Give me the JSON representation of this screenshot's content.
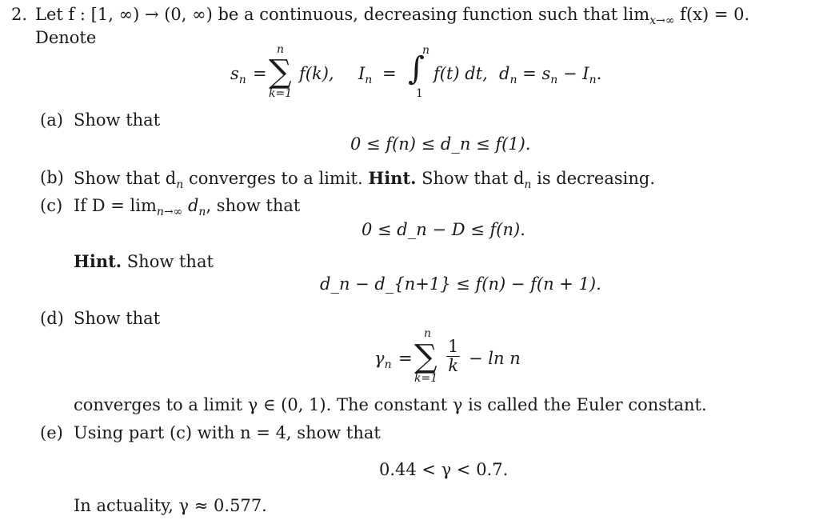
{
  "problem": {
    "number": "2.",
    "intro_line1": "Let f : [1, ∞) → (0, ∞) be a continuous, decreasing function such that lim",
    "intro_lim_sub": "x→∞",
    "intro_line1_end": " f(x) = 0.",
    "intro_line2": "Denote",
    "definitions": {
      "s_lhs": "s",
      "n": "n",
      "sum_upper": "n",
      "sum_lower": "k=1",
      "sum_body": "f(k),",
      "I_lhs": "I",
      "integral_upper": "n",
      "integral_lower": "1",
      "integral_body": "f(t) dt,",
      "d_def": "d",
      "d_rhs": "= s",
      "d_rhs_end": "− I",
      "period": "."
    }
  },
  "parts": [
    {
      "label": "(a)",
      "text": "Show that",
      "display": "0 ≤ f(n) ≤ d_n ≤ f(1)."
    },
    {
      "label": "(b)",
      "text_before": "Show that d",
      "text_mid": " converges to a limit.",
      "hint_label": "Hint.",
      "hint_text": " Show that d",
      "hint_end": " is decreasing."
    },
    {
      "label": "(c)",
      "text_before": "If D = lim",
      "lim_sub": "n→∞",
      "text_after": " d",
      "text_end": ", show that",
      "display": "0 ≤ d_n − D ≤ f(n).",
      "hint_label": "Hint.",
      "hint_text": " Show that",
      "hint_display": "d_n − d_{n+1} ≤ f(n) − f(n + 1)."
    },
    {
      "label": "(d)",
      "text": "Show that",
      "display_lhs": "γ",
      "display_sum_upper": "n",
      "display_sum_lower": "k=1",
      "display_frac_num": "1",
      "display_frac_den": "k",
      "display_tail": "− ln n",
      "followup": "converges to a limit γ ∈ (0, 1). The constant γ is called the Euler constant."
    },
    {
      "label": "(e)",
      "text": "Using part (c) with n = 4, show that",
      "display": "0.44 < γ < 0.7.",
      "closing": "In actuality, γ ≈ 0.577."
    }
  ]
}
